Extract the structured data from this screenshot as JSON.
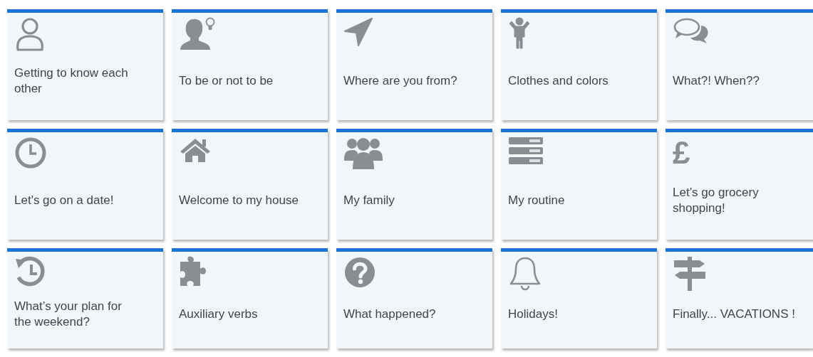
{
  "topics": [
    {
      "title": "Getting to know each other"
    },
    {
      "title": "To be or not to be"
    },
    {
      "title": "Where are you from?"
    },
    {
      "title": "Clothes and colors"
    },
    {
      "title": "What?! When??"
    },
    {
      "title": "Let's go on a date!"
    },
    {
      "title": "Welcome to my house"
    },
    {
      "title": "My family"
    },
    {
      "title": "My routine"
    },
    {
      "title": "Let’s go grocery shopping!",
      "glyph": "£"
    },
    {
      "title": "What’s your plan for the weekend?"
    },
    {
      "title": "Auxiliary verbs"
    },
    {
      "title": "What happened?"
    },
    {
      "title": "Holidays!"
    },
    {
      "title": "Finally... VACATIONS !"
    }
  ]
}
